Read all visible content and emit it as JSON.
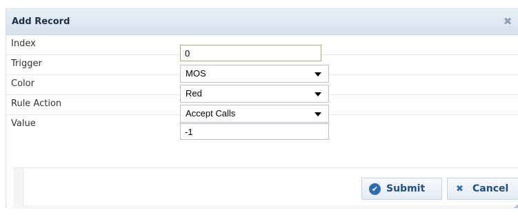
{
  "dialog": {
    "title": "Add Record",
    "close_icon": "close-icon"
  },
  "form": {
    "index": {
      "label": "Index",
      "value": "0"
    },
    "trigger": {
      "label": "Trigger",
      "value": "MOS"
    },
    "color": {
      "label": "Color",
      "value": "Red"
    },
    "rule_action": {
      "label": "Rule Action",
      "value": "Accept Calls"
    },
    "value": {
      "label": "Value",
      "value": "-1"
    }
  },
  "buttons": {
    "submit_label": "Submit",
    "cancel_label": "Cancel",
    "submit_icon": "check-circle-icon",
    "cancel_icon": "x-icon"
  },
  "colors": {
    "titlebar": "#d6e1ef",
    "button_text": "#1d4f86"
  }
}
